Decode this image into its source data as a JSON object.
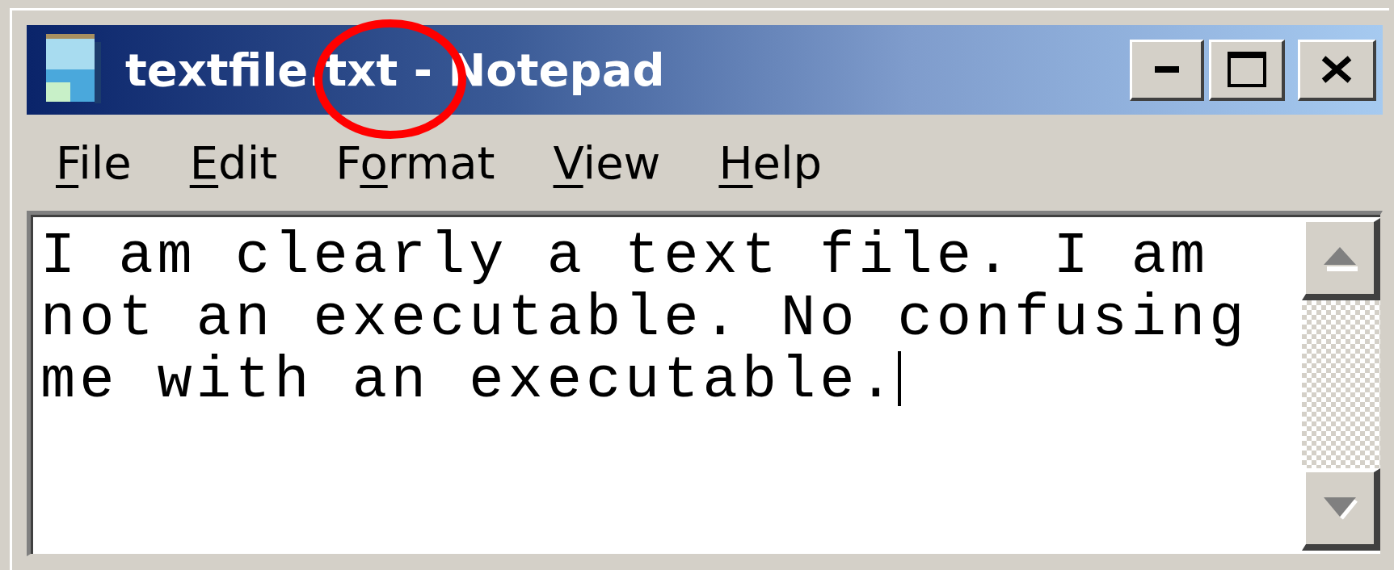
{
  "window": {
    "title": "textfile.txt - Notepad",
    "controls": [
      {
        "kind": "minimize"
      },
      {
        "kind": "maximize"
      },
      {
        "kind": "close"
      }
    ]
  },
  "menu": [
    {
      "access_key": "F",
      "rest": "ile"
    },
    {
      "access_key": "E",
      "rest": "dit"
    },
    {
      "prefix": "F",
      "access_key": "o",
      "rest": "rmat"
    },
    {
      "access_key": "V",
      "rest": "iew"
    },
    {
      "access_key": "H",
      "rest": "elp"
    }
  ],
  "document": {
    "text": "I am clearly a text file. I am\nnot an executable. No confusing\nme with an executable.",
    "caret": true
  },
  "annotations": [
    {
      "kind": "ellipse"
    }
  ]
}
